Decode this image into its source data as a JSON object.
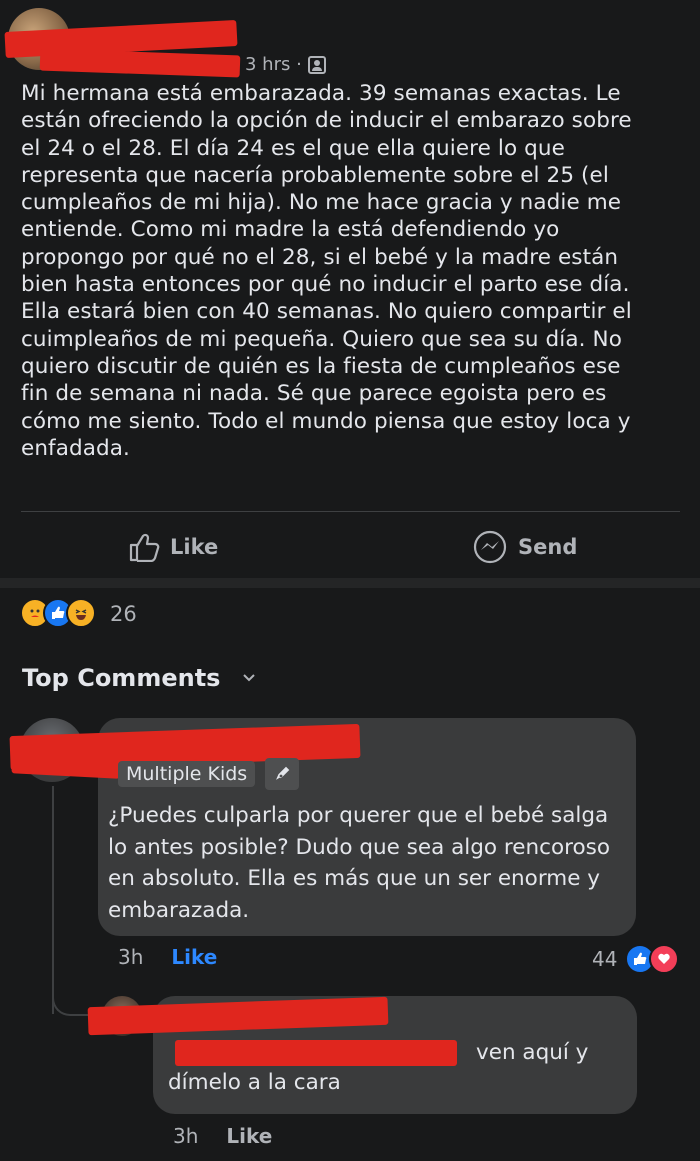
{
  "post": {
    "timestamp": "3 hrs ·",
    "audience_icon": "friends-audience-icon",
    "text": "Mi hermana está embarazada. 39 semanas exactas. Le\nestán ofreciendo la opción de inducir el embarazo sobre\nel 24 o el 28. El día 24 es el que ella quiere lo que\nrepresenta que nacería probablemente sobre el 25 (el\ncumpleaños de mi hija). No me hace gracia y nadie me\nentiende. Como mi madre la está defendiendo yo\npropongo por qué no el 28, si el bebé y la madre están\nbien hasta entonces por qué no inducir el parto ese día.\nElla estará bien con 40 semanas. No quiero compartir el\ncuimpleaños de mi pequeña. Quiero que sea su día. No\nquiero discutir de quién es la fiesta de cumpleaños ese\nfin de semana ni nada.  Sé que parece egoista pero es\ncómo me siento. Todo el mundo piensa que estoy loca y\nenfadada."
  },
  "actions": {
    "like_label": "Like",
    "send_label": "Send"
  },
  "reactions": {
    "types": [
      "care",
      "like",
      "haha"
    ],
    "count": "26"
  },
  "comments_header": {
    "label": "Top Comments"
  },
  "comments": [
    {
      "badge": "Multiple Kids",
      "badge_icon": "pen-icon",
      "text": "¿Puedes culparla por querer que el bebé salga lo antes posible? Dudo que sea algo rencoroso en absoluto. Ella es más que un ser enorme y embarazada.",
      "time": "3h",
      "like_label": "Like",
      "reaction_count": "44",
      "reaction_types": [
        "like",
        "love"
      ]
    },
    {
      "text_line1": "ven aquí y",
      "text_line2": "dímelo a la cara",
      "time": "3h",
      "like_label": "Like"
    }
  ],
  "colors": {
    "background": "#18191a",
    "bubble": "#3a3b3c",
    "text": "#e4e6eb",
    "secondary": "#b0b3b8",
    "link_blue": "#2d88ff",
    "redaction": "#e0261e"
  }
}
